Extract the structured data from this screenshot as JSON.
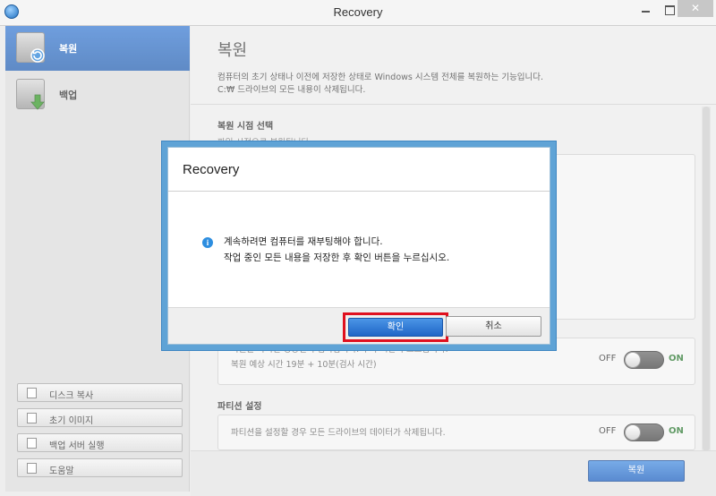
{
  "window": {
    "title": "Recovery",
    "close_glyph": "✕"
  },
  "sidebar": {
    "items": [
      {
        "label": "복원",
        "icon": "restore-icon",
        "active": true
      },
      {
        "label": "백업",
        "icon": "backup-icon",
        "active": false
      }
    ],
    "tools": [
      {
        "label": "디스크 복사",
        "icon": "disk-copy-icon"
      },
      {
        "label": "초기 이미지",
        "icon": "initial-image-icon"
      },
      {
        "label": "백업 서버 실행",
        "icon": "backup-server-icon"
      },
      {
        "label": "도움말",
        "icon": "help-icon"
      }
    ]
  },
  "main": {
    "title": "복원",
    "description": [
      "컴퓨터의 초기 상태나 이전에 저장한 상태로 Windows 시스템 전체를 복원하는 기능입니다.",
      "C:₩ 드라이브의 모든 내용이 삭제됩니다."
    ],
    "restore_point": {
      "heading": "복원 시점 선택",
      "sub": "파일 시점으로 복원됩니다."
    },
    "partial_panel_text": "복원을 마치면 정상인지 검사합니다. 두가 시간이 소요됩니다.",
    "estimate_text": "복원 예상 시간 19분 + 10분(검사 시간)",
    "partition": {
      "heading": "파티션 설정",
      "text": "파티션을 설정할 경우 모든 드라이브의 데이터가 삭제됩니다."
    },
    "toggle_off": "OFF",
    "toggle_on": "ON",
    "recover_button": "복원"
  },
  "dialog": {
    "title": "Recovery",
    "info_glyph": "i",
    "message": [
      "계속하려면 컴퓨터를 재부팅해야 합니다.",
      "작업 중인 모든 내용을 저장한 후 확인 버튼을 누르십시오."
    ],
    "ok_label": "확인",
    "cancel_label": "취소",
    "highlight_color": "#e0101f"
  }
}
